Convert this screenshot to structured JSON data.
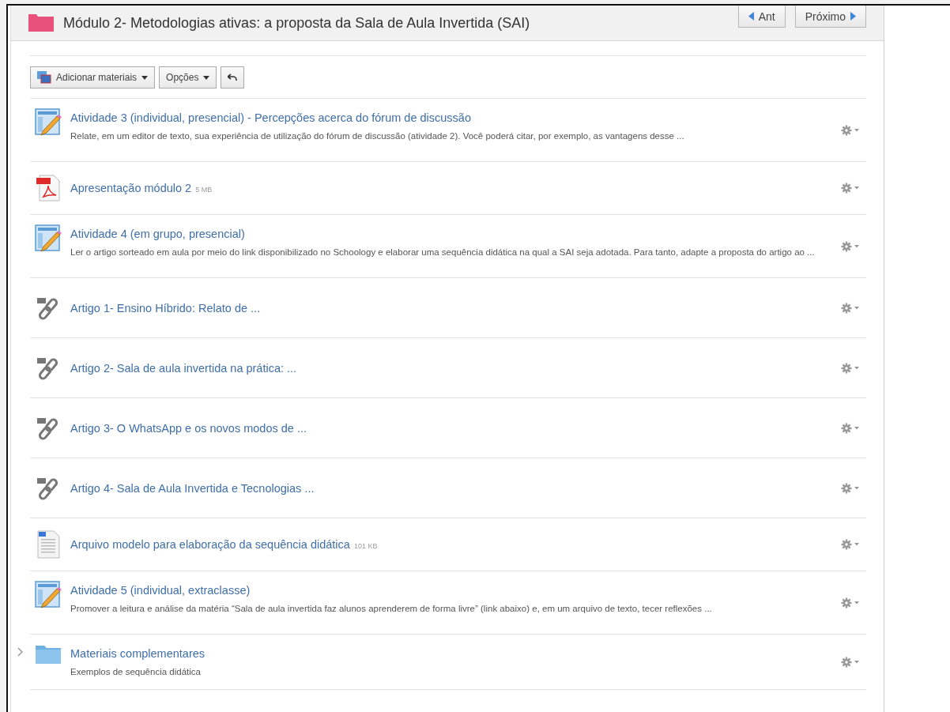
{
  "header": {
    "title": "Módulo 2- Metodologias ativas: a proposta da Sala de Aula Invertida (SAI)",
    "prev": "Ant",
    "next": "Próximo"
  },
  "toolbar": {
    "add": "Adicionar materiais",
    "options": "Opções"
  },
  "items": [
    {
      "kind": "assignment",
      "title": "Atividade 3 (individual, presencial) - Percepções acerca do fórum de discussão",
      "description": "Relate, em um editor de texto, sua experiência de utilização do fórum de discussão (atividade 2). Você poderá citar, por exemplo, as vantagens desse ..."
    },
    {
      "kind": "pdf",
      "title": "Apresentação módulo 2",
      "size": "5 MB"
    },
    {
      "kind": "assignment",
      "title": "Atividade 4 (em grupo, presencial)",
      "description": "Ler o artigo sorteado em aula por meio do link disponibilizado no Schoology e elaborar uma sequência didática na qual a SAI seja adotada. Para tanto, adapte a proposta do artigo ao ..."
    },
    {
      "kind": "link",
      "title": "Artigo 1- Ensino Híbrido: Relato de ..."
    },
    {
      "kind": "link",
      "title": "Artigo 2- Sala de aula invertida na prática: ..."
    },
    {
      "kind": "link",
      "title": "Artigo 3- O WhatsApp e os novos modos de ..."
    },
    {
      "kind": "link",
      "title": "Artigo 4- Sala de Aula Invertida e Tecnologias ..."
    },
    {
      "kind": "document",
      "title": "Arquivo modelo para elaboração da sequência didática",
      "size": "101 KB"
    },
    {
      "kind": "assignment",
      "title": "Atividade 5 (individual, extraclasse)",
      "description": "Promover a leitura e análise da matéria “Sala de aula invertida faz alunos aprenderem de forma livre” (link abaixo) e, em um arquivo de texto, tecer reflexões ..."
    },
    {
      "kind": "folder",
      "title": "Materiais complementares",
      "description": "Exemplos de sequência didática",
      "expanded": false
    }
  ]
}
